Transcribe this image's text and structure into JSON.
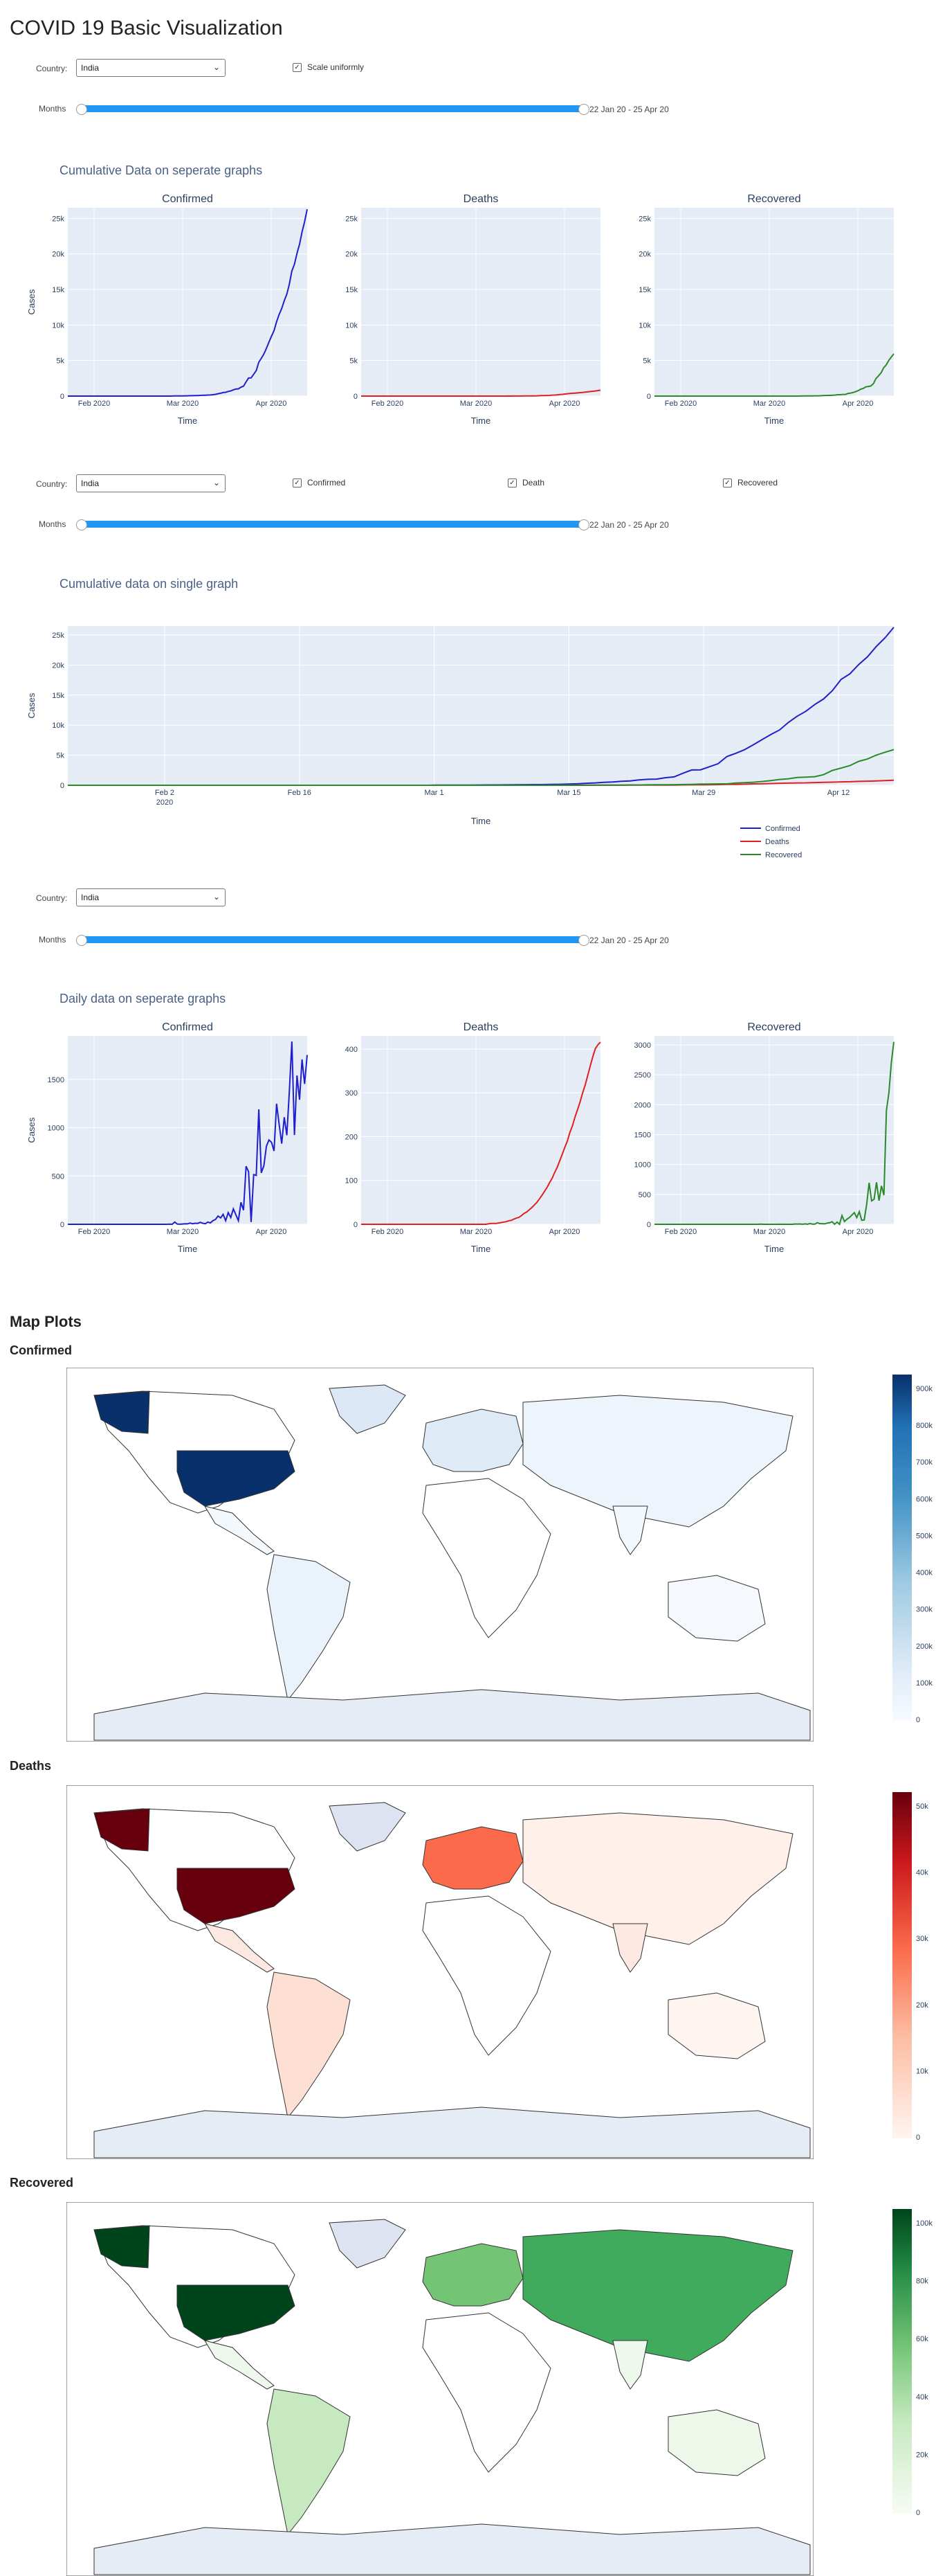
{
  "page_title": "COVID 19 Basic Visualization",
  "controls": [
    {
      "country_label": "Country:",
      "country_value": "India",
      "checkboxes": [
        {
          "label": "Scale uniformly",
          "checked": true
        }
      ],
      "months_label": "Months",
      "range_label": "22 Jan 20 - 25 Apr 20"
    },
    {
      "country_label": "Country:",
      "country_value": "India",
      "checkboxes": [
        {
          "label": "Confirmed",
          "checked": true
        },
        {
          "label": "Death",
          "checked": true
        },
        {
          "label": "Recovered",
          "checked": true
        }
      ],
      "months_label": "Months",
      "range_label": "22 Jan 20 - 25 Apr 20"
    },
    {
      "country_label": "Country:",
      "country_value": "India",
      "checkboxes": [],
      "months_label": "Months",
      "range_label": "22 Jan 20 - 25 Apr 20"
    }
  ],
  "sections": {
    "cumulative_separate": "Cumulative Data on seperate graphs",
    "cumulative_single": "Cumulative data on single graph",
    "daily_separate": "Daily data on seperate graphs",
    "map_plots": "Map Plots",
    "map_confirmed": "Confirmed",
    "map_deaths": "Deaths",
    "map_recovered": "Recovered"
  },
  "colors": {
    "confirmed": "#1f1fcc",
    "deaths": "#e02020",
    "recovered": "#2a8a2a",
    "plot_bg": "#e5ecf6",
    "slider": "#2196f3",
    "ocean": "#ffffff",
    "land_bg": "#e5ecf6"
  },
  "chart_data": [
    {
      "type": "line",
      "title": "Confirmed",
      "xlabel": "Time",
      "ylabel": "Cases",
      "xticks": [
        "Feb 2020",
        "Mar 2020",
        "Apr 2020"
      ],
      "yticks": [
        "0",
        "5k",
        "10k",
        "15k",
        "20k",
        "25k"
      ],
      "ylim": [
        0,
        26500
      ],
      "series": [
        {
          "values": [
            0,
            0,
            0,
            0,
            0,
            0,
            0,
            3,
            3,
            3,
            3,
            3,
            3,
            3,
            3,
            3,
            3,
            3,
            3,
            3,
            3,
            3,
            3,
            3,
            3,
            3,
            3,
            3,
            3,
            3,
            3,
            3,
            3,
            3,
            3,
            3,
            3,
            3,
            3,
            3,
            3,
            5,
            28,
            30,
            31,
            34,
            39,
            43,
            56,
            62,
            73,
            82,
            102,
            113,
            119,
            142,
            156,
            194,
            244,
            330,
            396,
            499,
            536,
            657,
            727,
            887,
            987,
            1024,
            1251,
            1397,
            1998,
            2543,
            2567,
            3082,
            3588,
            4778,
            5311,
            5916,
            6725,
            7598,
            8446,
            9205,
            10453,
            11487,
            12322,
            13430,
            14352,
            15722,
            17615,
            18539,
            20080,
            21370,
            23077,
            24530,
            26283
          ]
        }
      ]
    },
    {
      "type": "line",
      "title": "Deaths",
      "xlabel": "Time",
      "ylabel": "",
      "xticks": [
        "Feb 2020",
        "Mar 2020",
        "Apr 2020"
      ],
      "yticks": [
        "0",
        "5k",
        "10k",
        "15k",
        "20k",
        "25k"
      ],
      "ylim": [
        0,
        26500
      ],
      "series": [
        {
          "values": [
            0,
            0,
            0,
            0,
            0,
            0,
            0,
            0,
            0,
            0,
            0,
            0,
            0,
            0,
            0,
            0,
            0,
            0,
            0,
            0,
            0,
            0,
            0,
            0,
            0,
            0,
            0,
            0,
            0,
            0,
            0,
            0,
            0,
            0,
            0,
            0,
            0,
            0,
            0,
            0,
            0,
            0,
            0,
            0,
            0,
            0,
            0,
            0,
            0,
            0,
            1,
            2,
            2,
            2,
            2,
            3,
            3,
            4,
            5,
            4,
            7,
            10,
            10,
            12,
            20,
            20,
            24,
            27,
            32,
            35,
            58,
            72,
            72,
            86,
            99,
            136,
            150,
            178,
            226,
            246,
            288,
            331,
            358,
            393,
            405,
            448,
            486,
            521,
            559,
            592,
            645,
            681,
            721,
            780,
            825
          ]
        }
      ]
    },
    {
      "type": "line",
      "title": "Recovered",
      "xlabel": "Time",
      "ylabel": "",
      "xticks": [
        "Feb 2020",
        "Mar 2020",
        "Apr 2020"
      ],
      "yticks": [
        "0",
        "5k",
        "10k",
        "15k",
        "20k",
        "25k"
      ],
      "ylim": [
        0,
        26500
      ],
      "series": [
        {
          "values": [
            0,
            0,
            0,
            0,
            0,
            0,
            0,
            0,
            0,
            0,
            0,
            0,
            0,
            0,
            0,
            0,
            0,
            0,
            0,
            0,
            0,
            0,
            0,
            0,
            0,
            0,
            0,
            0,
            0,
            0,
            0,
            0,
            0,
            0,
            0,
            0,
            0,
            0,
            0,
            0,
            0,
            0,
            0,
            3,
            3,
            3,
            3,
            3,
            3,
            3,
            3,
            4,
            4,
            4,
            4,
            4,
            4,
            10,
            14,
            20,
            20,
            27,
            27,
            40,
            43,
            45,
            73,
            84,
            95,
            102,
            123,
            148,
            191,
            192,
            229,
            229,
            375,
            421,
            506,
            620,
            774,
            969,
            1080,
            1292,
            1359,
            1432,
            1768,
            2463,
            2854,
            3273,
            3975,
            4370,
            5012,
            5498,
            5939
          ]
        }
      ]
    },
    {
      "type": "line",
      "title": "",
      "xlabel": "Time",
      "ylabel": "Cases",
      "xticks": [
        "Feb 2\n2020",
        "Feb 16",
        "Mar 1",
        "Mar 15",
        "Mar 29",
        "Apr 12"
      ],
      "yticks": [
        "0",
        "5k",
        "10k",
        "15k",
        "20k",
        "25k"
      ],
      "ylim": [
        0,
        26500
      ],
      "series": [
        {
          "name": "Confirmed",
          "values": [
            0,
            0,
            0,
            0,
            0,
            0,
            0,
            3,
            3,
            3,
            3,
            3,
            3,
            3,
            3,
            3,
            3,
            3,
            3,
            3,
            3,
            3,
            3,
            3,
            3,
            3,
            3,
            3,
            3,
            3,
            3,
            3,
            3,
            3,
            3,
            3,
            3,
            3,
            3,
            3,
            3,
            5,
            28,
            30,
            31,
            34,
            39,
            43,
            56,
            62,
            73,
            82,
            102,
            113,
            119,
            142,
            156,
            194,
            244,
            330,
            396,
            499,
            536,
            657,
            727,
            887,
            987,
            1024,
            1251,
            1397,
            1998,
            2543,
            2567,
            3082,
            3588,
            4778,
            5311,
            5916,
            6725,
            7598,
            8446,
            9205,
            10453,
            11487,
            12322,
            13430,
            14352,
            15722,
            17615,
            18539,
            20080,
            21370,
            23077,
            24530,
            26283
          ]
        },
        {
          "name": "Deaths",
          "values": [
            0,
            0,
            0,
            0,
            0,
            0,
            0,
            0,
            0,
            0,
            0,
            0,
            0,
            0,
            0,
            0,
            0,
            0,
            0,
            0,
            0,
            0,
            0,
            0,
            0,
            0,
            0,
            0,
            0,
            0,
            0,
            0,
            0,
            0,
            0,
            0,
            0,
            0,
            0,
            0,
            0,
            0,
            0,
            0,
            0,
            0,
            0,
            0,
            0,
            0,
            1,
            2,
            2,
            2,
            2,
            3,
            3,
            4,
            5,
            4,
            7,
            10,
            10,
            12,
            20,
            20,
            24,
            27,
            32,
            35,
            58,
            72,
            72,
            86,
            99,
            136,
            150,
            178,
            226,
            246,
            288,
            331,
            358,
            393,
            405,
            448,
            486,
            521,
            559,
            592,
            645,
            681,
            721,
            780,
            825
          ]
        },
        {
          "name": "Recovered",
          "values": [
            0,
            0,
            0,
            0,
            0,
            0,
            0,
            0,
            0,
            0,
            0,
            0,
            0,
            0,
            0,
            0,
            0,
            0,
            0,
            0,
            0,
            0,
            0,
            0,
            0,
            0,
            0,
            0,
            0,
            0,
            0,
            0,
            0,
            0,
            0,
            0,
            0,
            0,
            0,
            0,
            0,
            0,
            0,
            3,
            3,
            3,
            3,
            3,
            3,
            3,
            3,
            4,
            4,
            4,
            4,
            4,
            4,
            10,
            14,
            20,
            20,
            27,
            27,
            40,
            43,
            45,
            73,
            84,
            95,
            102,
            123,
            148,
            191,
            192,
            229,
            229,
            375,
            421,
            506,
            620,
            774,
            969,
            1080,
            1292,
            1359,
            1432,
            1768,
            2463,
            2854,
            3273,
            3975,
            4370,
            5012,
            5498,
            5939
          ]
        }
      ]
    },
    {
      "type": "line",
      "title": "Confirmed",
      "xlabel": "Time",
      "ylabel": "Cases",
      "xticks": [
        "Feb 2020",
        "Mar 2020",
        "Apr 2020"
      ],
      "yticks": [
        "0",
        "500",
        "1000",
        "1500"
      ],
      "ylim": [
        0,
        1950
      ],
      "series": [
        {
          "values": [
            0,
            0,
            0,
            0,
            0,
            0,
            0,
            0,
            0,
            0,
            0,
            0,
            0,
            0,
            0,
            0,
            0,
            0,
            0,
            0,
            0,
            0,
            0,
            0,
            0,
            0,
            0,
            0,
            0,
            0,
            0,
            0,
            0,
            0,
            0,
            0,
            0,
            0,
            0,
            0,
            2,
            0,
            23,
            2,
            1,
            3,
            5,
            4,
            13,
            6,
            11,
            9,
            20,
            11,
            6,
            23,
            14,
            38,
            50,
            86,
            66,
            103,
            37,
            121,
            70,
            160,
            100,
            37,
            227,
            146,
            601,
            545,
            24,
            515,
            506,
            1190,
            533,
            605,
            809,
            873,
            848,
            759,
            1248,
            1034,
            835,
            1108,
            922,
            1370,
            1893,
            924,
            1541,
            1290,
            1707,
            1453,
            1753
          ]
        }
      ]
    },
    {
      "type": "line",
      "title": "Deaths",
      "xlabel": "Time",
      "ylabel": "",
      "xticks": [
        "Feb 2020",
        "Mar 2020",
        "Apr 2020"
      ],
      "yticks": [
        "0",
        "100",
        "200",
        "300",
        "400"
      ],
      "ylim": [
        0,
        430
      ],
      "series": [
        {
          "values": [
            0,
            0,
            0,
            0,
            0,
            0,
            0,
            0,
            0,
            0,
            0,
            0,
            0,
            0,
            0,
            0,
            0,
            0,
            0,
            0,
            0,
            0,
            0,
            0,
            0,
            0,
            0,
            0,
            0,
            0,
            0,
            0,
            0,
            0,
            0,
            0,
            0,
            0,
            0,
            0,
            0,
            0,
            0,
            0,
            0,
            0,
            0,
            0,
            0,
            0,
            1,
            2,
            2,
            2,
            3,
            4,
            5,
            6,
            8,
            9,
            12,
            14,
            16,
            20,
            25,
            28,
            33,
            38,
            44,
            50,
            58,
            66,
            75,
            84,
            95,
            105,
            118,
            130,
            145,
            160,
            176,
            190,
            210,
            225,
            245,
            262,
            280,
            300,
            318,
            340,
            362,
            383,
            401,
            410,
            416
          ]
        }
      ]
    },
    {
      "type": "line",
      "title": "Recovered",
      "xlabel": "Time",
      "ylabel": "",
      "xticks": [
        "Feb 2020",
        "Mar 2020",
        "Apr 2020"
      ],
      "yticks": [
        "0",
        "500",
        "1000",
        "1500",
        "2000",
        "2500",
        "3000"
      ],
      "ylim": [
        0,
        3150
      ],
      "series": [
        {
          "values": [
            0,
            0,
            0,
            0,
            0,
            0,
            0,
            0,
            0,
            0,
            0,
            0,
            0,
            0,
            0,
            0,
            0,
            0,
            0,
            0,
            0,
            0,
            0,
            0,
            0,
            0,
            0,
            0,
            0,
            0,
            0,
            0,
            0,
            0,
            0,
            0,
            0,
            0,
            0,
            0,
            0,
            0,
            0,
            3,
            0,
            0,
            0,
            0,
            0,
            0,
            0,
            1,
            0,
            0,
            0,
            0,
            0,
            6,
            4,
            6,
            0,
            7,
            0,
            13,
            3,
            2,
            28,
            11,
            11,
            7,
            21,
            25,
            43,
            1,
            37,
            0,
            146,
            46,
            85,
            114,
            154,
            195,
            111,
            212,
            67,
            73,
            336,
            695,
            391,
            419,
            702,
            395,
            642,
            486,
            1900,
            2200,
            2700,
            3050
          ]
        }
      ]
    }
  ],
  "maps": {
    "confirmed": {
      "colorbar_ticks": [
        "0",
        "100k",
        "200k",
        "300k",
        "400k",
        "500k",
        "600k",
        "700k",
        "800k",
        "900k"
      ],
      "colorscale": [
        "#f7fbff",
        "#deebf7",
        "#9ecae1",
        "#4292c6",
        "#2171b5",
        "#08306b"
      ]
    },
    "deaths": {
      "colorbar_ticks": [
        "0",
        "10k",
        "20k",
        "30k",
        "40k",
        "50k"
      ],
      "colorscale": [
        "#fff5f0",
        "#fcbba1",
        "#fb6a4a",
        "#cb181d",
        "#67000d"
      ]
    },
    "recovered": {
      "colorbar_ticks": [
        "0",
        "20k",
        "40k",
        "60k",
        "80k",
        "100k"
      ],
      "colorscale": [
        "#f7fcf5",
        "#c7e9c0",
        "#74c476",
        "#238b45",
        "#00441b"
      ]
    }
  }
}
